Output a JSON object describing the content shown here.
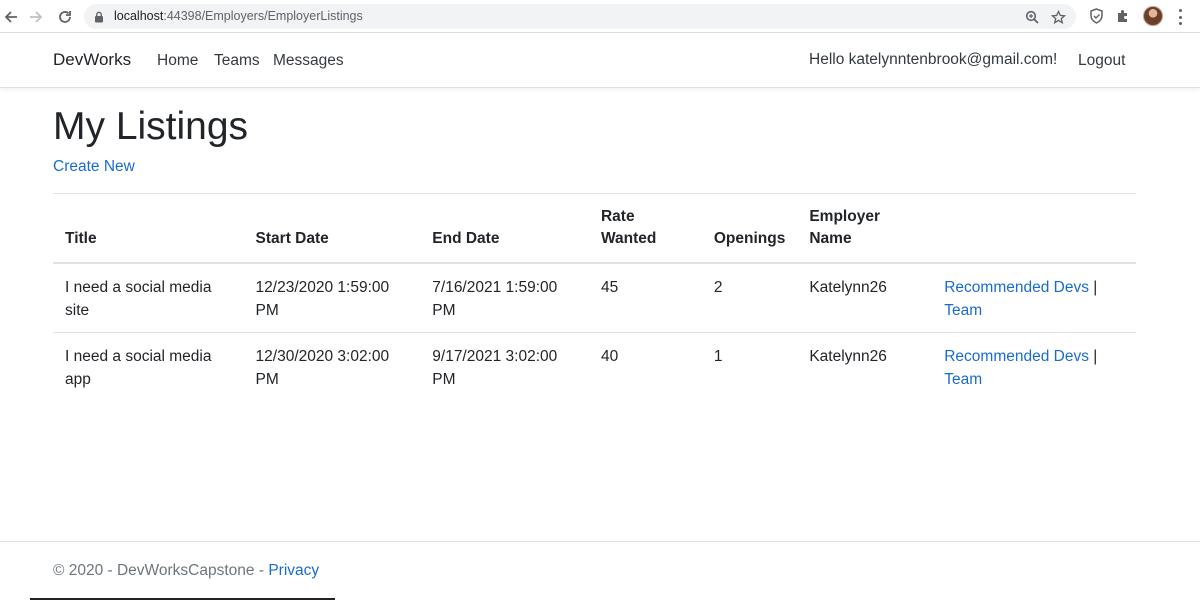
{
  "browser": {
    "url_host": "localhost",
    "url_rest": ":44398/Employers/EmployerListings"
  },
  "navbar": {
    "brand": "DevWorks",
    "links": [
      "Home",
      "Teams",
      "Messages"
    ],
    "hello": "Hello katelynntenbrook@gmail.com!",
    "logout": "Logout"
  },
  "main": {
    "title": "My Listings",
    "create_new": "Create New",
    "table": {
      "headers": [
        "Title",
        "Start Date",
        "End Date",
        "Rate Wanted",
        "Openings",
        "Employer Name",
        ""
      ],
      "rows": [
        {
          "title": "I need a social media site",
          "start": "12/23/2020 1:59:00 PM",
          "end": "7/16/2021 1:59:00 PM",
          "rate": "45",
          "openings": "2",
          "employer": "Katelynn26",
          "link1": "Recommended Devs",
          "sep": " |",
          "link2": "Team"
        },
        {
          "title": "I need a social media app",
          "start": "12/30/2020 3:02:00 PM",
          "end": "9/17/2021 3:02:00 PM",
          "rate": "40",
          "openings": "1",
          "employer": "Katelynn26",
          "link1": "Recommended Devs",
          "sep": " |",
          "link2": "Team"
        }
      ]
    }
  },
  "footer": {
    "text": "© 2020 - DevWorksCapstone - ",
    "privacy": "Privacy"
  },
  "colors": {
    "link": "#1a6bd1",
    "text": "#212529",
    "muted": "#6c757d",
    "border": "#dee2e6"
  }
}
